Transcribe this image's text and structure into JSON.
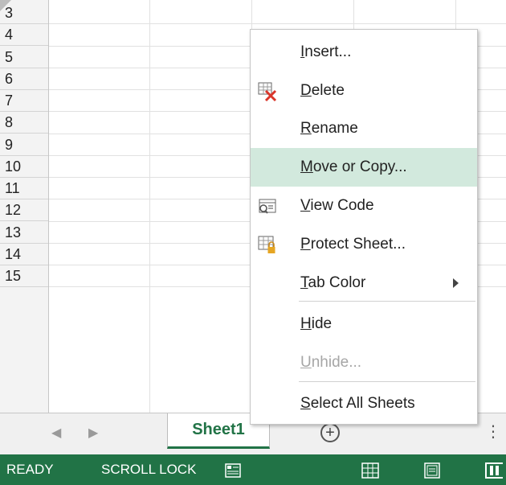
{
  "grid": {
    "row_numbers": [
      "3",
      "4",
      "5",
      "6",
      "7",
      "8",
      "9",
      "10",
      "11",
      "12",
      "13",
      "14",
      "15"
    ]
  },
  "context_menu": {
    "items": [
      {
        "pre": "",
        "key": "I",
        "post": "nsert...",
        "icon": "",
        "state": "normal"
      },
      {
        "pre": "",
        "key": "D",
        "post": "elete",
        "icon": "delete-sheet-icon",
        "state": "normal"
      },
      {
        "pre": "",
        "key": "R",
        "post": "ename",
        "icon": "",
        "state": "normal"
      },
      {
        "pre": "",
        "key": "M",
        "post": "ove or Copy...",
        "icon": "",
        "state": "highlighted"
      },
      {
        "pre": "",
        "key": "V",
        "post": "iew Code",
        "icon": "view-code-icon",
        "state": "normal"
      },
      {
        "pre": "",
        "key": "P",
        "post": "rotect Sheet...",
        "icon": "protect-sheet-icon",
        "state": "normal"
      },
      {
        "pre": "",
        "key": "T",
        "post": "ab Color",
        "icon": "",
        "state": "normal",
        "submenu": true
      },
      {
        "pre": "",
        "key": "H",
        "post": "ide",
        "icon": "",
        "state": "normal"
      },
      {
        "pre": "",
        "key": "U",
        "post": "nhide...",
        "icon": "",
        "state": "disabled"
      },
      {
        "pre": "",
        "key": "S",
        "post": "elect All Sheets",
        "icon": "",
        "state": "normal"
      }
    ]
  },
  "sheet_tabs": {
    "prev_icon": "◀",
    "next_icon": "▶",
    "active_tab": "Sheet1",
    "new_sheet_icon": "+",
    "more_icon": "⋮"
  },
  "status_bar": {
    "mode": "READY",
    "scroll_lock": "SCROLL LOCK",
    "accent_color": "#217346"
  },
  "colors": {
    "menu_highlight": "#d2e9dd",
    "status_bar": "#217346",
    "tab_text": "#217346"
  }
}
